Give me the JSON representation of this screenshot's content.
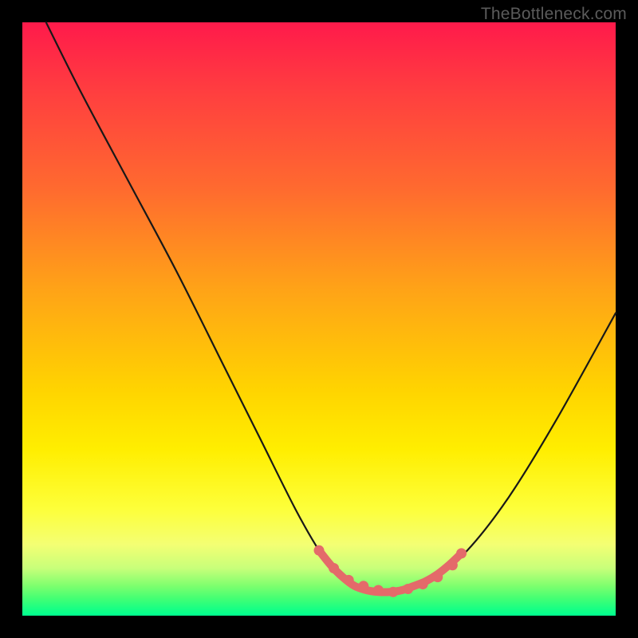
{
  "watermark": "TheBottleneck.com",
  "colors": {
    "background": "#000000",
    "curve": "#181818",
    "accent": "#e46a6a",
    "gradient_top": "#ff1a4b",
    "gradient_bottom": "#00ff8f"
  },
  "chart_data": {
    "type": "line",
    "title": "",
    "xlabel": "",
    "ylabel": "",
    "xlim": [
      0,
      100
    ],
    "ylim": [
      0,
      100
    ],
    "grid": false,
    "legend": false,
    "note": "V-shaped bottleneck curve; x and y are percentage positions across the plot area (0=left/bottom, 100=right/top). The curve descends from upper-left to a flat trough near the bottom center, then rises to the right with lower slope. The accent series and dots highlight the trough region.",
    "series": [
      {
        "name": "bottleneck-curve",
        "x": [
          4,
          10,
          18,
          26,
          34,
          40,
          46,
          50,
          53,
          56,
          59,
          62,
          66,
          70,
          75,
          82,
          90,
          100
        ],
        "y": [
          100,
          88,
          73,
          58,
          42,
          30,
          18,
          11,
          7,
          5,
          4,
          4,
          5,
          7,
          11,
          20,
          33,
          51
        ]
      },
      {
        "name": "trough-accent",
        "x": [
          50,
          52,
          54,
          56,
          58,
          60,
          62,
          64,
          66,
          68,
          70,
          72,
          74
        ],
        "y": [
          11,
          8.5,
          6.5,
          5,
          4.3,
          4,
          4,
          4.3,
          5,
          5.8,
          7,
          8.6,
          10.5
        ]
      }
    ],
    "dots": [
      {
        "x": 50,
        "y": 11
      },
      {
        "x": 52.5,
        "y": 8
      },
      {
        "x": 55,
        "y": 6
      },
      {
        "x": 57.5,
        "y": 5
      },
      {
        "x": 60,
        "y": 4.3
      },
      {
        "x": 62.5,
        "y": 4
      },
      {
        "x": 65,
        "y": 4.5
      },
      {
        "x": 67.5,
        "y": 5.3
      },
      {
        "x": 70,
        "y": 6.5
      },
      {
        "x": 72.5,
        "y": 8.5
      },
      {
        "x": 74,
        "y": 10.5
      }
    ]
  }
}
